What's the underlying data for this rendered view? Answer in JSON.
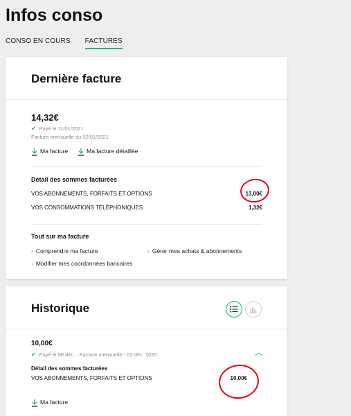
{
  "page": {
    "title": "Infos conso"
  },
  "tabs": [
    {
      "label": "CONSO EN COURS",
      "active": false
    },
    {
      "label": "FACTURES",
      "active": true
    }
  ],
  "derniere_facture": {
    "title": "Dernière facture",
    "amount": "14,32€",
    "paid": "Payé le 11/01/2021",
    "period": "Facture mensuelle du 02/01/2021",
    "links": [
      "Ma facture",
      "Ma facture détaillée"
    ],
    "detail": {
      "title": "Détail des sommes facturées",
      "rows": [
        {
          "label": "VOS ABONNEMENTS, FORFAITS ET OPTIONS",
          "value": "13,00€"
        },
        {
          "label": "VOS CONSOMMATIONS TÉLÉPHONIQUES",
          "value": "1,32€"
        }
      ]
    },
    "tout_sur": {
      "title": "Tout sur ma facture",
      "links": [
        "Comprendre ma facture",
        "Gérer mes achats & abonnements",
        "Modifier mes coordonnées bancaires"
      ]
    }
  },
  "historique": {
    "title": "Historique",
    "item": {
      "amount": "10,00€",
      "paid": "Payé le 08 déc. - Facture mensuelle - 02 déc. 2020",
      "detail_title": "Détail des sommes facturées",
      "row": {
        "label": "VOS ABONNEMENTS, FORFAITS ET OPTIONS",
        "value": "10,00€"
      },
      "link": "Ma facture"
    }
  },
  "colors": {
    "accent": "#1fb48a",
    "annotation": "#e0001a"
  }
}
